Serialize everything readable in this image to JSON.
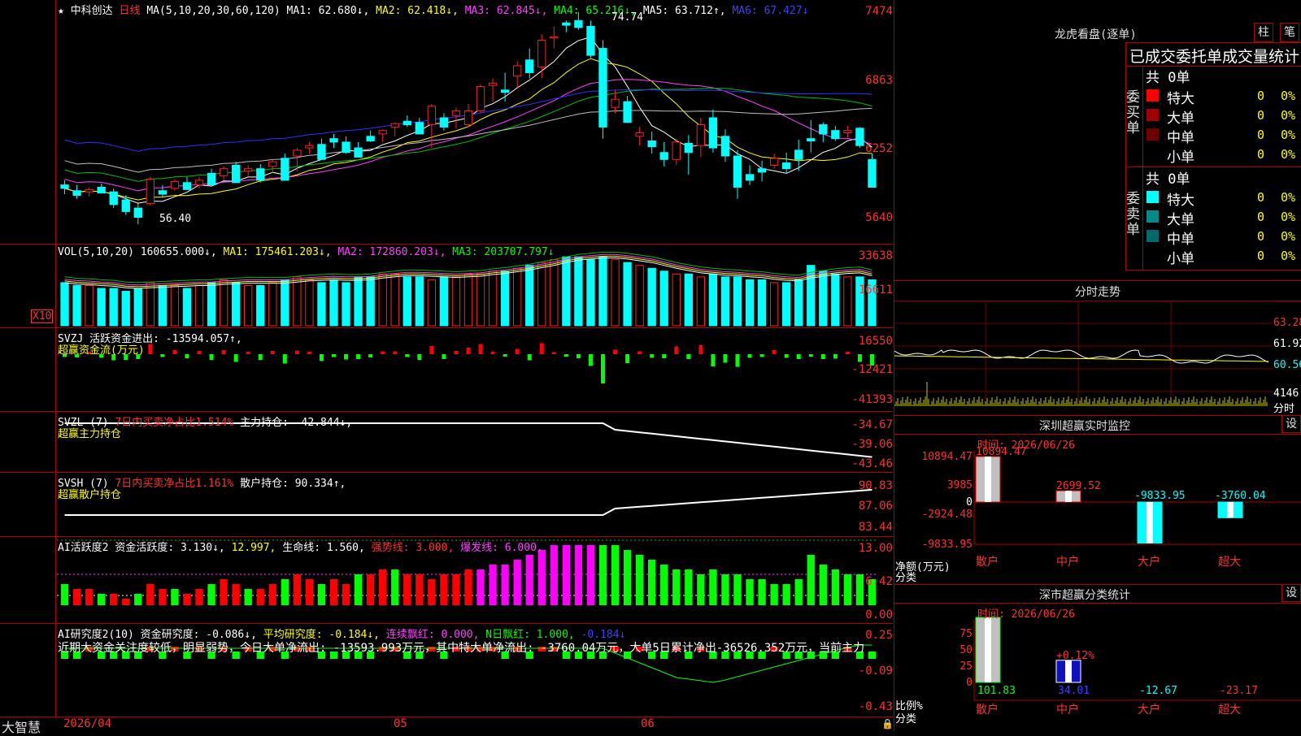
{
  "stock": {
    "star": "★",
    "name": "中科创达",
    "period": "日线"
  },
  "colors": {
    "up": "#ff2020",
    "down": "#00ffff",
    "bg": "#000000",
    "grid": "#b00000"
  },
  "main_header": {
    "ma_label": "MA(5,10,20,30,60,120)",
    "ma1": "MA1: 62.680↓,",
    "ma2": "MA2: 62.418↓,",
    "ma3": "MA3: 62.845↓,",
    "ma4": "MA4: 65.216↓,",
    "ma5": "MA5: 63.712↑,",
    "ma6": "MA6: 67.427↓"
  },
  "main_axis": {
    "top": "7474",
    "l1": "6863",
    "l2": "6252",
    "l3": "5640"
  },
  "main_marks": {
    "high": "74.74",
    "low": "56.40"
  },
  "vol_header": {
    "label": "VOL(5,10,20)",
    "val": "160655.000↓,",
    "ma1": "MA1: 175461.203↓,",
    "ma2": "MA2: 172860.203↓,",
    "ma3": "MA3: 203707.797↓"
  },
  "vol_axis": {
    "a": "33638",
    "b": "16611",
    "unit": "X10"
  },
  "svzj": {
    "label": "SVZJ",
    "text": "活跃资金进出: -13594.057↑,",
    "sub": "超赢资金流(万元)",
    "a": "16550",
    "b": "-12421",
    "c": "-41393"
  },
  "svzl": {
    "label": "SVZL (7)",
    "text": "7日内买卖净占比1.514%",
    "hold": "主力持仓: -42.844↓,",
    "sub": "超赢主力持仓",
    "a": "-34.67",
    "b": "-39.06",
    "c": "-43.46"
  },
  "svsh": {
    "label": "SVSH (7)",
    "text": "7日内买卖净占比1.161%",
    "hold": "散户持仓: 90.334↑,",
    "sub": "超赢散户持仓",
    "a": "90.83",
    "b": "87.06",
    "c": "83.44"
  },
  "ai1": {
    "label": "AI活跃度2",
    "t1": "资金活跃度: 3.130↓,",
    "t2": "12.997,",
    "t3": "生命线: 1.560,",
    "t4": "强势线: 3.000,",
    "t5": "爆发线: 6.000,",
    "a": "13.00",
    "b": "6.42",
    "c": "0.00"
  },
  "ai2": {
    "label": "AI研究度2(10)",
    "t1": "资金研究度: -0.086↓,",
    "t2": "平均研究度: -0.184↓,",
    "t3": "连续飘红: 0.000,",
    "t4": "N日飘红: 1.000,",
    "t5": "-0.184↓",
    "comment": "近期大资金关注度较低，明显弱势，今日大单净流出: -13593.993万元，其中特大单净流出: -3760.04万元，大单5日累计净出-36526.352万元，当前主力",
    "a": "0.25",
    "b": "-0.09",
    "c": "-0.43"
  },
  "bottom": {
    "brand": "大智慧",
    "date": "2026/04",
    "m5": "05",
    "m6": "06"
  },
  "right_panel": {
    "title": "龙虎看盘(逐单)",
    "btn1": "柱",
    "btn2": "笔",
    "stat_title": "已成交委托单成交量统计",
    "buy": {
      "side": "委买单",
      "total": "共 0单",
      "rows": [
        {
          "name": "特大",
          "count": "0",
          "pct": "0%",
          "color": "#ff0000"
        },
        {
          "name": "大单",
          "count": "0",
          "pct": "0%",
          "color": "#a00000"
        },
        {
          "name": "中单",
          "count": "0",
          "pct": "0%",
          "color": "#700000"
        },
        {
          "name": "小单",
          "count": "0",
          "pct": "0%",
          "color": "#000000"
        }
      ]
    },
    "sell": {
      "side": "委卖单",
      "total": "共 0单",
      "rows": [
        {
          "name": "特大",
          "count": "0",
          "pct": "0%",
          "color": "#00ffff"
        },
        {
          "name": "大单",
          "count": "0",
          "pct": "0%",
          "color": "#008b8b"
        },
        {
          "name": "中单",
          "count": "0",
          "pct": "0%",
          "color": "#006a6a"
        },
        {
          "name": "小单",
          "count": "0",
          "pct": "0%",
          "color": "#000000"
        }
      ]
    },
    "intraday": {
      "title": "分时走势",
      "p1": "63.28",
      "p2": "61.92",
      "p3": "60.56",
      "vol": "4146",
      "unit": "分时"
    },
    "monitor": {
      "title": "深圳超赢实时监控",
      "time": "时间: 2026/06/26",
      "btn": "设",
      "ymax": "10894.47",
      "y1": "3985",
      "y0": "0",
      "y2": "-2924.48",
      "ymin": "-9833.95",
      "ylabel": "净额(万元)",
      "xlabel": "分类",
      "bars": [
        {
          "cat": "散户",
          "val": "10894.47"
        },
        {
          "cat": "中户",
          "val": "2699.52"
        },
        {
          "cat": "大户",
          "val": "-9833.95"
        },
        {
          "cat": "超大",
          "val": "-3760.04"
        }
      ]
    },
    "classify": {
      "title": "深市超赢分类统计",
      "time": "时间: 2026/06/26",
      "btn": "设",
      "y75": "75",
      "y50": "50",
      "y25": "25",
      "y0": "0",
      "ylabel": "比例%",
      "xlabel": "分类",
      "bars": [
        {
          "cat": "散户",
          "val": "101.83"
        },
        {
          "cat": "中户",
          "val": "34.01",
          "top": "+0.12%"
        },
        {
          "cat": "大户",
          "val": "-12.67"
        },
        {
          "cat": "超大",
          "val": "-23.17"
        }
      ]
    }
  },
  "chart_data": {
    "type": "candlestick",
    "ohlc": [
      [
        59.8,
        60.2,
        59.0,
        59.5
      ],
      [
        59.3,
        59.8,
        58.6,
        58.9
      ],
      [
        59.2,
        59.6,
        58.8,
        59.4
      ],
      [
        59.6,
        59.9,
        59.2,
        59.1
      ],
      [
        59.2,
        59.5,
        57.8,
        58.1
      ],
      [
        58.5,
        58.9,
        57.2,
        57.5
      ],
      [
        57.8,
        58.2,
        56.4,
        57.0
      ],
      [
        58.2,
        60.5,
        58.0,
        60.3
      ],
      [
        59.3,
        59.8,
        58.8,
        59.0
      ],
      [
        59.5,
        60.3,
        59.3,
        60.1
      ],
      [
        60.0,
        60.5,
        59.5,
        59.4
      ],
      [
        59.8,
        60.5,
        59.5,
        60.2
      ],
      [
        60.8,
        61.2,
        60.3,
        59.8
      ],
      [
        60.6,
        61.4,
        60.2,
        61.2
      ],
      [
        61.5,
        61.8,
        60.6,
        60.0
      ],
      [
        61.0,
        61.5,
        60.5,
        61.2
      ],
      [
        61.2,
        61.6,
        60.0,
        60.2
      ],
      [
        61.4,
        62.0,
        60.8,
        61.8
      ],
      [
        62.1,
        62.5,
        60.6,
        60.2
      ],
      [
        62.3,
        63.0,
        61.0,
        62.8
      ],
      [
        63.0,
        63.5,
        62.5,
        63.2
      ],
      [
        63.3,
        63.8,
        62.3,
        62.0
      ],
      [
        63.8,
        64.2,
        63.0,
        63.5
      ],
      [
        63.5,
        64.0,
        62.5,
        62.6
      ],
      [
        63.0,
        63.5,
        62.4,
        62.2
      ],
      [
        64.0,
        64.5,
        63.5,
        63.6
      ],
      [
        64.2,
        64.6,
        63.5,
        64.5
      ],
      [
        64.8,
        65.2,
        64.0,
        65.1
      ],
      [
        65.3,
        65.8,
        64.8,
        65.0
      ],
      [
        65.2,
        65.6,
        64.3,
        64.2
      ],
      [
        65.0,
        66.8,
        63.0,
        66.6
      ],
      [
        65.6,
        66.0,
        64.5,
        64.8
      ],
      [
        65.8,
        66.5,
        64.7,
        66.2
      ],
      [
        65.0,
        66.8,
        64.8,
        66.2
      ],
      [
        66.2,
        68.5,
        66.0,
        68.3
      ],
      [
        68.4,
        69.0,
        67.0,
        68.6
      ],
      [
        68.0,
        69.5,
        67.0,
        67.8
      ],
      [
        69.2,
        70.5,
        68.2,
        70.1
      ],
      [
        70.6,
        71.6,
        69.0,
        69.5
      ],
      [
        70.0,
        72.8,
        69.0,
        72.3
      ],
      [
        72.5,
        73.5,
        71.6,
        72.6
      ],
      [
        73.8,
        74.0,
        73.0,
        73.6
      ],
      [
        74.0,
        74.74,
        73.2,
        73.4
      ],
      [
        73.5,
        74.0,
        70.8,
        71.0
      ],
      [
        71.6,
        72.3,
        63.8,
        64.8
      ],
      [
        66.5,
        68.0,
        66.0,
        67.2
      ],
      [
        67.0,
        67.5,
        65.6,
        65.2
      ],
      [
        64.0,
        64.8,
        63.2,
        64.3
      ],
      [
        63.6,
        64.4,
        62.5,
        63.1
      ],
      [
        62.6,
        63.5,
        61.4,
        62.0
      ],
      [
        62.0,
        63.8,
        61.5,
        63.5
      ],
      [
        63.4,
        64.1,
        60.7,
        62.6
      ],
      [
        63.2,
        65.6,
        62.2,
        65.0
      ],
      [
        65.6,
        66.3,
        62.6,
        63.0
      ],
      [
        64.0,
        64.6,
        61.8,
        62.3
      ],
      [
        62.3,
        62.8,
        58.6,
        59.6
      ],
      [
        60.7,
        61.5,
        59.8,
        60.2
      ],
      [
        61.2,
        61.9,
        60.1,
        60.9
      ],
      [
        61.5,
        62.5,
        61.2,
        62.1
      ],
      [
        61.7,
        62.6,
        60.8,
        61.2
      ],
      [
        62.8,
        63.7,
        61.0,
        62.0
      ],
      [
        63.8,
        65.4,
        62.6,
        63.6
      ],
      [
        65.0,
        65.2,
        63.5,
        64.2
      ],
      [
        64.5,
        64.9,
        63.6,
        63.8
      ],
      [
        64.3,
        64.9,
        63.9,
        64.5
      ],
      [
        64.7,
        64.8,
        63.0,
        63.2
      ],
      [
        62.0,
        62.5,
        59.6,
        59.6
      ]
    ],
    "volume": [
      15,
      14,
      14,
      13,
      13,
      12,
      13,
      15,
      14,
      14,
      13,
      14,
      15,
      16,
      15,
      14,
      14,
      15,
      16,
      17,
      16,
      15,
      16,
      15,
      17,
      17,
      18,
      18,
      17,
      17,
      16,
      17,
      17,
      18,
      18,
      19,
      19,
      20,
      21,
      22,
      23,
      24,
      24,
      23,
      24,
      23,
      22,
      21,
      20,
      19,
      18,
      18,
      17,
      18,
      17,
      17,
      16,
      16,
      15,
      15,
      16,
      21,
      19,
      18,
      17,
      17,
      16
    ],
    "main_ylim": [
      55.0,
      75.5
    ]
  }
}
